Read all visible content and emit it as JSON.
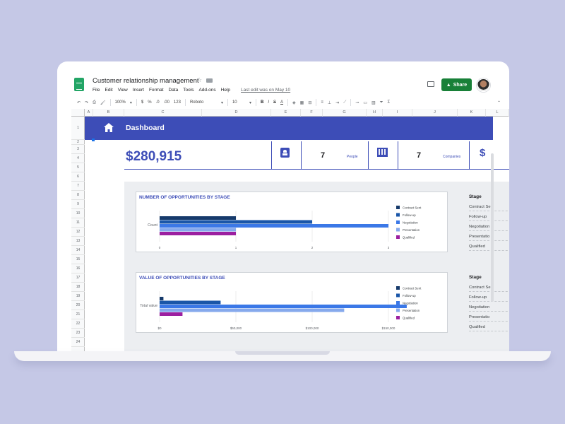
{
  "app": {
    "title": "Customer relationship management",
    "menu": [
      "File",
      "Edit",
      "View",
      "Insert",
      "Format",
      "Data",
      "Tools",
      "Add-ons",
      "Help"
    ],
    "last_edit": "Last edit was on May 10",
    "share_label": "Share"
  },
  "toolbar": {
    "zoom": "100%",
    "currency": "$",
    "percent": "%",
    "decimals_less": ".0",
    "decimals_more": ".00",
    "number_format": "123",
    "font": "Roboto",
    "font_size": "10",
    "bold": "B",
    "italic": "I",
    "strike": "S",
    "text_color": "A"
  },
  "columns": [
    "A",
    "B",
    "C",
    "D",
    "E",
    "F",
    "G",
    "H",
    "I",
    "J",
    "K",
    "L"
  ],
  "rows": [
    "1",
    "2",
    "3",
    "4",
    "5",
    "6",
    "7",
    "8",
    "9",
    "10",
    "11",
    "12",
    "13",
    "14",
    "15",
    "16",
    "17",
    "18",
    "19",
    "20",
    "21",
    "22",
    "23",
    "24"
  ],
  "dashboard": {
    "title": "Dashboard",
    "total_value": "$280,915",
    "people_count": "7",
    "people_label": "People",
    "companies_count": "7",
    "companies_label": "Companies"
  },
  "stage_tables": [
    {
      "header": "Stage",
      "items": [
        "Contract Se",
        "Follow-up",
        "Negotiation",
        "Presentatio",
        "Qualified"
      ]
    },
    {
      "header": "Stage",
      "items": [
        "Contract Se",
        "Follow-up",
        "Negotiation",
        "Presentatio",
        "Qualified"
      ]
    }
  ],
  "colors": {
    "brand": "#3d4db7",
    "share": "#188038",
    "contract_sent": "#163a6b",
    "follow_up": "#1a56a8",
    "negotiation": "#3b78e7",
    "presentation": "#86a9ec",
    "qualified": "#9c1fa0"
  },
  "chart_data": [
    {
      "type": "bar",
      "orientation": "horizontal",
      "title": "NUMBER OF OPPORTUNITIES BY STAGE",
      "categories": [
        "Count"
      ],
      "series": [
        {
          "name": "Contract Sent",
          "values": [
            1
          ]
        },
        {
          "name": "Follow-up",
          "values": [
            2
          ]
        },
        {
          "name": "Negotiation",
          "values": [
            3
          ]
        },
        {
          "name": "Presentation",
          "values": [
            1
          ]
        },
        {
          "name": "Qualified",
          "values": [
            1
          ]
        }
      ],
      "xlim": [
        0,
        3
      ],
      "ticks": [
        "0",
        "1",
        "2",
        "3"
      ],
      "legend": "right",
      "grid": true
    },
    {
      "type": "bar",
      "orientation": "horizontal",
      "title": "VALUE OF OPPORTUNITIES BY STAGE",
      "categories": [
        "Total value"
      ],
      "series": [
        {
          "name": "Contract Sent",
          "values": [
            2500
          ]
        },
        {
          "name": "Follow-up",
          "values": [
            40000
          ]
        },
        {
          "name": "Negotiation",
          "values": [
            162000
          ]
        },
        {
          "name": "Presentation",
          "values": [
            121000
          ]
        },
        {
          "name": "Qualified",
          "values": [
            15000
          ]
        }
      ],
      "xlim": [
        0,
        150000
      ],
      "ticks": [
        "$0",
        "$50,000",
        "$100,000",
        "$150,000"
      ],
      "legend": "right",
      "grid": true
    }
  ]
}
